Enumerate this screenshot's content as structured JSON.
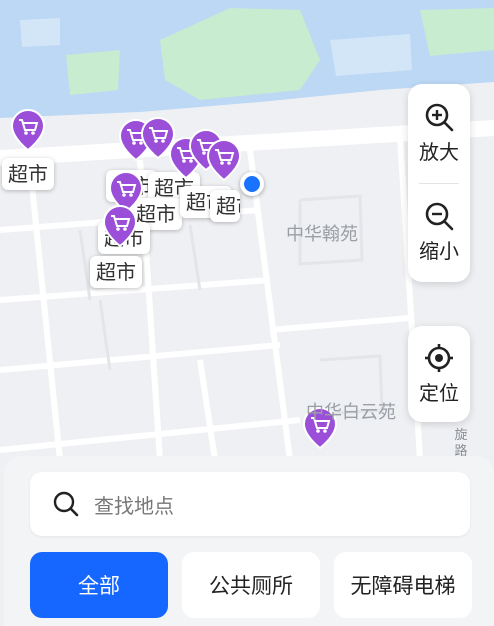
{
  "map": {
    "poi_labels": [
      "超市",
      "超市",
      "超市",
      "超市",
      "超市",
      "超市",
      "超市",
      "超市"
    ],
    "area_labels": [
      "中华翰苑",
      "中华白云苑"
    ],
    "road_label": "旋路"
  },
  "controls": {
    "zoom_in_label": "放大",
    "zoom_out_label": "缩小",
    "locate_label": "定位"
  },
  "search": {
    "placeholder": "查找地点"
  },
  "filters": [
    "全部",
    "公共厕所",
    "无障碍电梯"
  ],
  "colors": {
    "accent": "#1667ff",
    "pin": "#9b4fd8",
    "user_dot": "#1a73ff",
    "water": "#bcd8f5",
    "park": "#c7ecd0"
  }
}
